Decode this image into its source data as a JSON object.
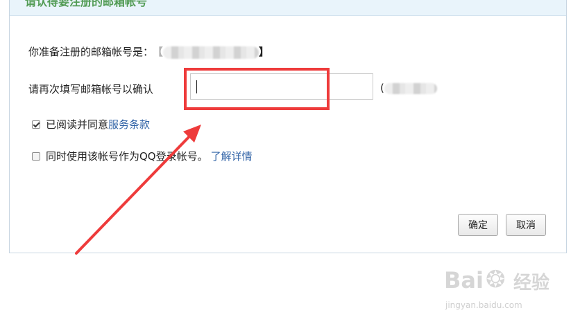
{
  "dialog": {
    "title": "请认得要注册的邮箱帐号"
  },
  "email_row": {
    "label": "你准备注册的邮箱帐号是：",
    "bracket_open": "【",
    "bracket_close": "】"
  },
  "confirm_row": {
    "label": "请再次填写邮箱帐号以确认",
    "value": "",
    "paren": "("
  },
  "agree_row": {
    "checked": true,
    "label": "已阅读并同意",
    "link": "服务条款"
  },
  "qq_row": {
    "checked": false,
    "label": "同时使用该帐号作为QQ登录帐号。",
    "link": "了解详情"
  },
  "buttons": {
    "ok": "确定",
    "cancel": "取消"
  },
  "watermark": {
    "brand": "Bai",
    "brand_cn": "经验",
    "url": "jingyan.baidu.com"
  },
  "annotation_color": "#ee3b3b"
}
